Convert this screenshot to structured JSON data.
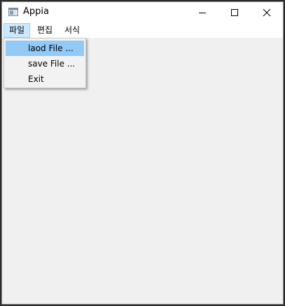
{
  "window": {
    "title": "Appia"
  },
  "caption_buttons": {
    "minimize_icon": "minimize-icon",
    "maximize_icon": "maximize-icon",
    "close_icon": "close-icon"
  },
  "menubar": {
    "items": [
      {
        "label": "파일",
        "active": true
      },
      {
        "label": "편집",
        "active": false
      },
      {
        "label": "서식",
        "active": false
      }
    ]
  },
  "file_menu": {
    "items": [
      {
        "label": "laod File ...",
        "highlighted": true
      },
      {
        "label": "save File ...",
        "highlighted": false
      },
      {
        "label": "Exit",
        "highlighted": false
      }
    ]
  },
  "colors": {
    "menu_active_bg": "#cce8ff",
    "menu_highlight_bg": "#91c9f7",
    "client_bg": "#f0f0f0"
  }
}
